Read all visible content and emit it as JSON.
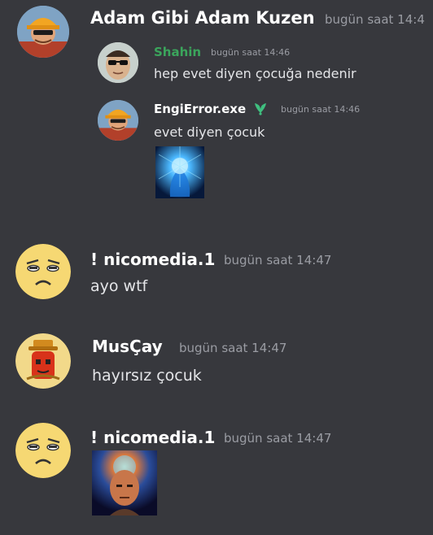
{
  "messages": [
    {
      "author": "Adam Gibi Adam Kuzen",
      "timestamp": "bugün saat 14:4",
      "avatar_icon": "engineer-avatar"
    },
    {
      "author": "Shahin",
      "author_color": "#3ba55c",
      "timestamp": "bugün saat 14:46",
      "text": "hep evet diyen çocuğa nedenir",
      "avatar_icon": "sunglasses-face-avatar"
    },
    {
      "author": "EngiError.exe",
      "timestamp": "bugün saat 14:46",
      "text": "evet diyen çocuk",
      "badge_icon": "green-leaf-badge-icon",
      "attachment_icon": "glowing-blue-brain-image",
      "avatar_icon": "engineer-avatar"
    },
    {
      "author": "! nicomedia.1",
      "timestamp": "bugün saat 14:47",
      "text": "ayo wtf",
      "avatar_icon": "yellow-frown-face-avatar"
    },
    {
      "author": "MusÇay",
      "timestamp": "bugün saat 14:47",
      "text": "hayırsız çocuk",
      "avatar_icon": "tea-pot-character-avatar"
    },
    {
      "author": "! nicomedia.1",
      "timestamp": "bugün saat 14:47",
      "attachment_icon": "galaxy-brain-face-image",
      "avatar_icon": "yellow-frown-face-avatar"
    }
  ],
  "colors": {
    "background": "#37383d",
    "username": "#ffffff",
    "timestamp": "#9a9ca3",
    "text": "#e4e5e8"
  }
}
